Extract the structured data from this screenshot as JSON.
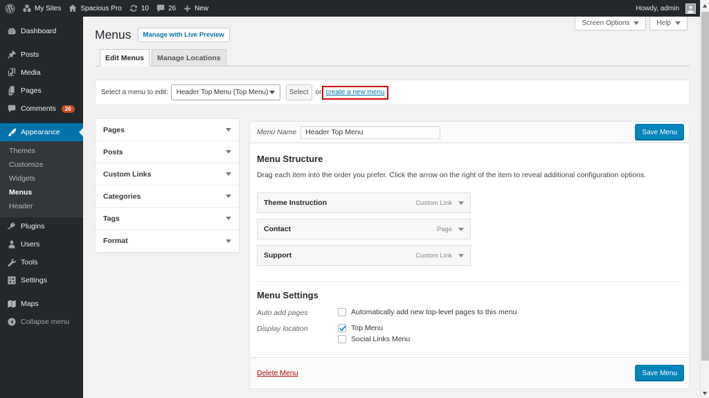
{
  "admin_bar": {
    "my_sites": "My Sites",
    "site_name": "Spacious Pro",
    "updates_count": "10",
    "comments_count": "26",
    "new_label": "New",
    "howdy": "Howdy, admin"
  },
  "sidebar": {
    "items": [
      {
        "label": "Dashboard"
      },
      {
        "label": "Posts"
      },
      {
        "label": "Media"
      },
      {
        "label": "Pages"
      },
      {
        "label": "Comments",
        "badge": "26"
      },
      {
        "label": "Appearance"
      },
      {
        "label": "Plugins"
      },
      {
        "label": "Users"
      },
      {
        "label": "Tools"
      },
      {
        "label": "Settings"
      },
      {
        "label": "Maps"
      },
      {
        "label": "Collapse menu"
      }
    ],
    "appearance_submenu": [
      {
        "label": "Themes"
      },
      {
        "label": "Customize"
      },
      {
        "label": "Widgets"
      },
      {
        "label": "Menus",
        "current": true
      },
      {
        "label": "Header"
      }
    ]
  },
  "screen_meta": {
    "screen_options": "Screen Options",
    "help": "Help"
  },
  "page": {
    "title": "Menus",
    "live_preview_button": "Manage with Live Preview",
    "tabs": [
      {
        "label": "Edit Menus"
      },
      {
        "label": "Manage Locations"
      }
    ]
  },
  "select_bar": {
    "label": "Select a menu to edit:",
    "dropdown_value": "Header Top Menu (Top Menu)",
    "select_button": "Select",
    "or_text": "or",
    "create_link": "create a new menu"
  },
  "accordion": {
    "sections": [
      {
        "label": "Pages"
      },
      {
        "label": "Posts"
      },
      {
        "label": "Custom Links"
      },
      {
        "label": "Categories"
      },
      {
        "label": "Tags"
      },
      {
        "label": "Format"
      }
    ]
  },
  "editor": {
    "menu_name_label": "Menu Name",
    "menu_name_value": "Header Top Menu",
    "save_button_top": "Save Menu",
    "structure": {
      "heading": "Menu Structure",
      "description": "Drag each item into the order you prefer. Click the arrow on the right of the item to reveal additional configuration options.",
      "items": [
        {
          "title": "Theme Instruction",
          "type": "Custom Link"
        },
        {
          "title": "Contact",
          "type": "Page"
        },
        {
          "title": "Support",
          "type": "Custom Link"
        }
      ]
    },
    "settings": {
      "heading": "Menu Settings",
      "auto_add_label": "Auto add pages",
      "auto_add_option": "Automatically add new top-level pages to this menu",
      "display_label": "Display location",
      "locations": [
        {
          "label": "Top Menu",
          "checked": true
        },
        {
          "label": "Social Links Menu",
          "checked": false
        }
      ]
    },
    "footer": {
      "delete_link": "Delete Menu",
      "save_button": "Save Menu"
    }
  },
  "colors": {
    "admin_accent": "#0073aa",
    "primary_button": "#0085ba",
    "badge": "#ca4a1f",
    "annotation": "#d40000",
    "delete_link": "#a00000"
  }
}
